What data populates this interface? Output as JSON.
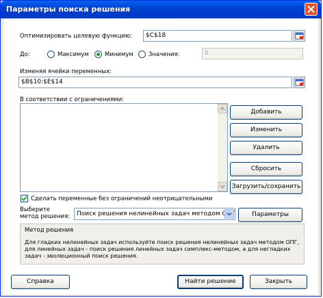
{
  "window": {
    "title": "Параметры поиска решения"
  },
  "objective": {
    "label": "Оптимизировать целевую функцию:",
    "value": "$C$18"
  },
  "to": {
    "label": "До:",
    "max_label": "Максимум",
    "min_label": "Минимум",
    "value_label": "Значения:",
    "value_field": "0",
    "selected": "Минимум"
  },
  "variables": {
    "label": "Изменяя ячейки переменных:",
    "value": "$B$10:$E$14"
  },
  "constraints": {
    "label": "В соответствии с ограничениями:",
    "items": []
  },
  "buttons": {
    "add": "Добавить",
    "change": "Изменить",
    "delete": "Удалить",
    "reset": "Сбросить",
    "load_save": "Загрузить/сохранить",
    "options": "Параметры",
    "help": "Справка",
    "solve": "Найти решение",
    "close": "Закрыть"
  },
  "nonneg": {
    "label": "Сделать переменные без ограничений неотрицательными",
    "checked": true
  },
  "method": {
    "label_line1": "Выберите",
    "label_line2": "метод решения:",
    "selected": "Поиск решения нелинейных задач методом ОПГ"
  },
  "method_group": {
    "title": "Метод решения",
    "line1": "Для гладких нелинейных задач используйте поиск решения нелинейных задач методом ОПГ,",
    "line2": "для линейных задач - поиск решения линейных задач симплекс-методом, а для негладких",
    "line3": "задач - эволюционный поиск решения."
  },
  "colors": {
    "title_bar": "#0044d4",
    "dialog_border": "#0831d9",
    "check_green": "#21a121"
  }
}
